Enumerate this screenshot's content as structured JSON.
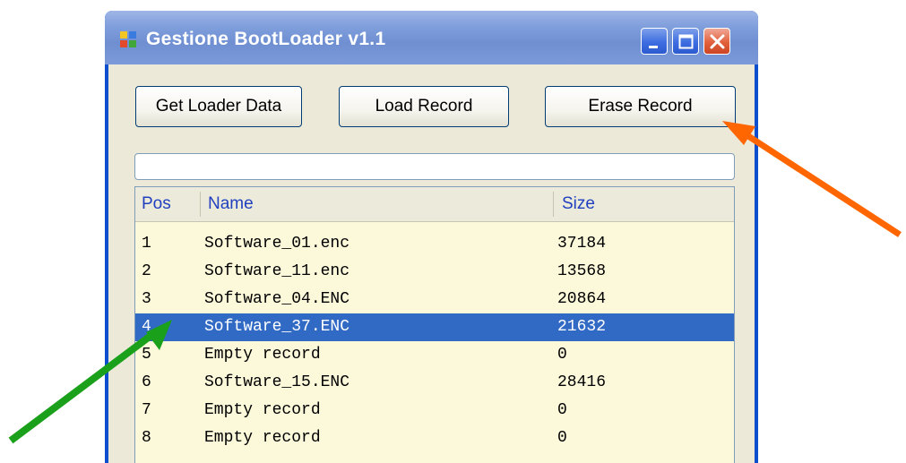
{
  "window": {
    "title": "Gestione BootLoader v1.1",
    "icon": "app-window-icon",
    "caption_buttons": [
      "minimize-icon",
      "maximize-icon",
      "close-icon"
    ]
  },
  "toolbar": {
    "get_loader_label": "Get Loader Data",
    "load_record_label": "Load Record",
    "erase_record_label": "Erase Record"
  },
  "progress": {
    "value": 0
  },
  "table": {
    "columns": [
      "Pos",
      "Name",
      "Size"
    ],
    "selected_index": 3,
    "rows": [
      {
        "pos": "1",
        "name": "Software_01.enc",
        "size": "37184"
      },
      {
        "pos": "2",
        "name": "Software_11.enc",
        "size": "13568"
      },
      {
        "pos": "3",
        "name": "Software_04.ENC",
        "size": "20864"
      },
      {
        "pos": "4",
        "name": "Software_37.ENC",
        "size": "21632"
      },
      {
        "pos": "5",
        "name": "Empty record",
        "size": "0"
      },
      {
        "pos": "6",
        "name": "Software_15.ENC",
        "size": "28416"
      },
      {
        "pos": "7",
        "name": "Empty record",
        "size": "0"
      },
      {
        "pos": "8",
        "name": "Empty record",
        "size": "0"
      }
    ]
  },
  "annotations": {
    "orange_arrow_color": "#ff6600",
    "green_arrow_color": "#1aa01a"
  },
  "colors": {
    "selection": "#316ac5",
    "list_background": "#fcf8da",
    "header_text": "#2140c0"
  }
}
